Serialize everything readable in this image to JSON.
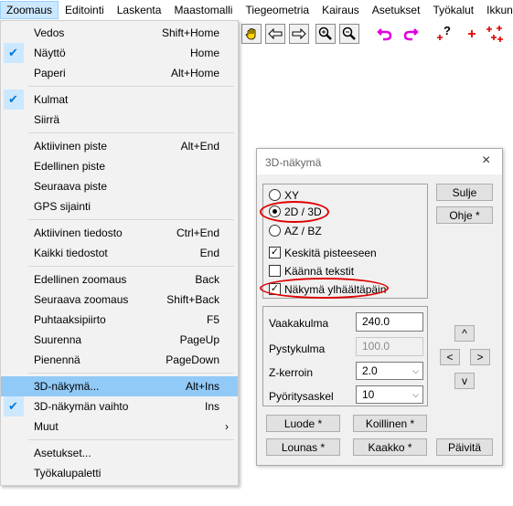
{
  "menubar": [
    "Zoomaus",
    "Editointi",
    "Laskenta",
    "Maastomalli",
    "Tiegeometria",
    "Kairaus",
    "Asetukset",
    "Työkalut",
    "Ikkuna"
  ],
  "menu": {
    "items": [
      {
        "label": "Vedos",
        "shortcut": "Shift+Home",
        "checked": false
      },
      {
        "label": "Näyttö",
        "shortcut": "Home",
        "checked": true
      },
      {
        "label": "Paperi",
        "shortcut": "Alt+Home",
        "checked": false
      },
      {
        "label": "Kulmat",
        "shortcut": "",
        "checked": true
      },
      {
        "label": "Siirrä",
        "shortcut": "",
        "checked": false
      },
      {
        "label": "Aktiivinen piste",
        "shortcut": "Alt+End",
        "checked": false
      },
      {
        "label": "Edellinen piste",
        "shortcut": "",
        "checked": false
      },
      {
        "label": "Seuraava piste",
        "shortcut": "",
        "checked": false
      },
      {
        "label": "GPS sijainti",
        "shortcut": "",
        "checked": false
      },
      {
        "label": "Aktiivinen tiedosto",
        "shortcut": "Ctrl+End",
        "checked": false
      },
      {
        "label": "Kaikki tiedostot",
        "shortcut": "End",
        "checked": false
      },
      {
        "label": "Edellinen zoomaus",
        "shortcut": "Back",
        "checked": false
      },
      {
        "label": "Seuraava zoomaus",
        "shortcut": "Shift+Back",
        "checked": false
      },
      {
        "label": "Puhtaaksipiirto",
        "shortcut": "F5",
        "checked": false
      },
      {
        "label": "Suurenna",
        "shortcut": "PageUp",
        "checked": false
      },
      {
        "label": "Pienennä",
        "shortcut": "PageDown",
        "checked": false
      },
      {
        "label": "3D-näkymä...",
        "shortcut": "Alt+Ins",
        "checked": false,
        "highlighted": true
      },
      {
        "label": "3D-näkymän vaihto",
        "shortcut": "Ins",
        "checked": true
      },
      {
        "label": "Muut",
        "shortcut": "›",
        "checked": false
      },
      {
        "label": "Asetukset...",
        "shortcut": "",
        "checked": false
      },
      {
        "label": "Työkalupaletti",
        "shortcut": "",
        "checked": false
      }
    ]
  },
  "dialog": {
    "title": "3D-näkymä",
    "close": "×",
    "radios": [
      {
        "label": "XY",
        "selected": false
      },
      {
        "label": "2D / 3D",
        "selected": true
      },
      {
        "label": "AZ / BZ",
        "selected": false
      }
    ],
    "checks": [
      {
        "label": "Keskitä pisteeseen",
        "checked": true
      },
      {
        "label": "Käännä tekstit",
        "checked": false
      },
      {
        "label": "Näkymä ylhäältäpäin",
        "checked": true
      }
    ],
    "fields": {
      "vaakakulma_label": "Vaakakulma",
      "vaakakulma": "240.0",
      "pystykulma_label": "Pystykulma",
      "pystykulma": "100.0",
      "zkerroin_label": "Z-kerroin",
      "zkerroin": "2.0",
      "pyoritysaskel_label": "Pyöritysaskel",
      "pyoritysaskel": "10"
    },
    "buttons": {
      "sulje": "Sulje",
      "ohje": "Ohje *",
      "up": "^",
      "left": "<",
      "right": ">",
      "down": "v",
      "luode": "Luode *",
      "koillinen": "Koillinen *",
      "lounas": "Lounas *",
      "kaakko": "Kaakko *",
      "paivita": "Päivitä"
    }
  },
  "toolbar": {
    "icons": [
      "pan-hand-icon",
      "arrow-left-icon",
      "arrow-right-icon",
      "zoom-in-icon",
      "zoom-out-icon",
      "undo-icon",
      "redo-icon",
      "point-query-icon",
      "add-point-icon",
      "add-points-icon"
    ],
    "query_glyph": "?"
  }
}
